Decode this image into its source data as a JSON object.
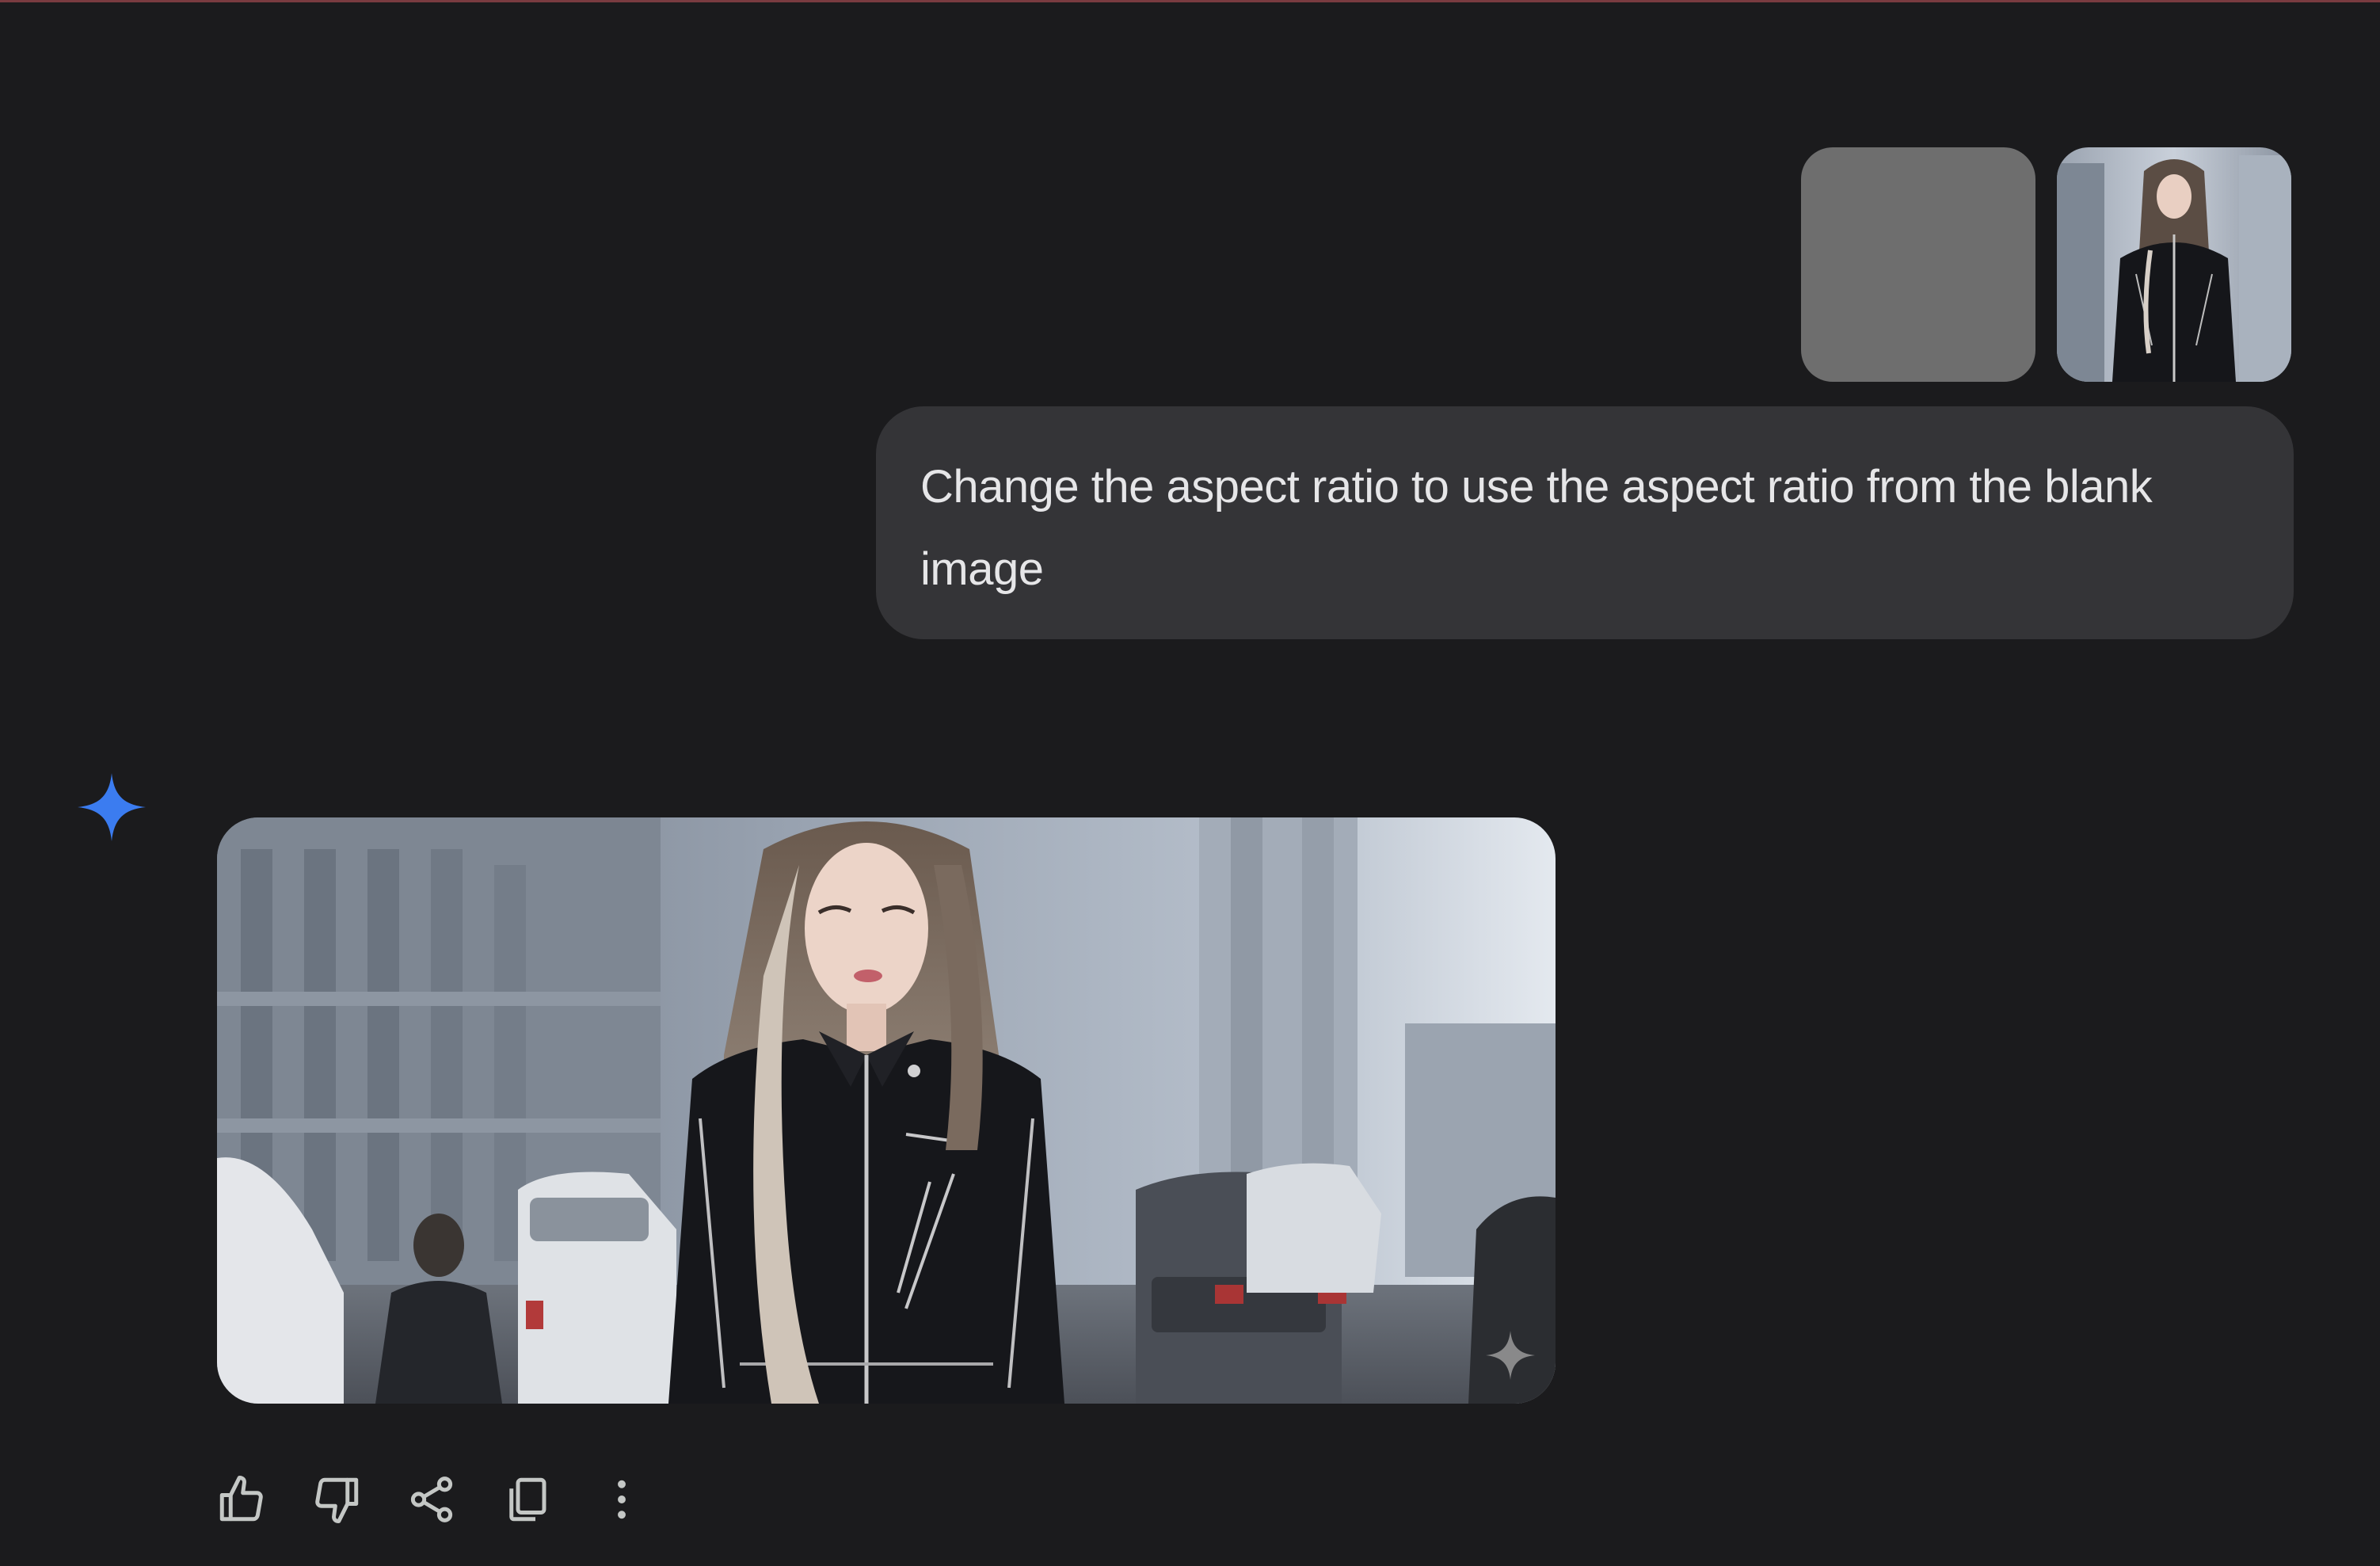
{
  "conversation": {
    "user_turn": {
      "attachments": [
        {
          "kind": "blank-image",
          "color": "#6e6e6e"
        },
        {
          "kind": "photo"
        }
      ],
      "prompt": "Change the aspect ratio to use the aspect ratio from the blank image"
    },
    "model_turn": {
      "avatar_icon": "gemini-spark-icon",
      "image_watermark_icon": "spark-watermark-icon"
    }
  },
  "actions": [
    {
      "name": "thumbs-up-icon"
    },
    {
      "name": "thumbs-down-icon"
    },
    {
      "name": "share-icon"
    },
    {
      "name": "copy-icon"
    },
    {
      "name": "more-vert-icon"
    }
  ],
  "colors": {
    "background": "#1b1b1d",
    "bubble": "#343437",
    "text": "#e6e6e8",
    "spark_blue": "#3b7cf0"
  }
}
